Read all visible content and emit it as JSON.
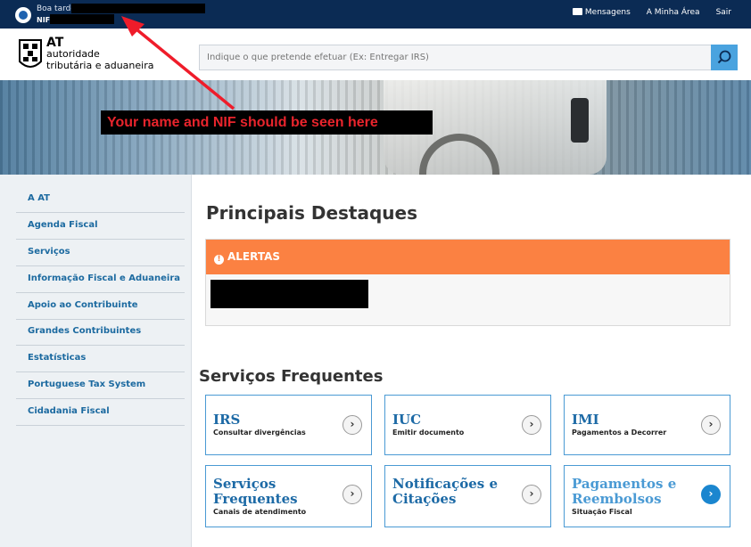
{
  "topbar": {
    "greeting": "Boa tarde",
    "nif_label": "NIF",
    "links": {
      "messages": "Mensagens",
      "my_area": "A Minha Área",
      "logout": "Sair"
    }
  },
  "header": {
    "logo": {
      "at": "AT",
      "line2": "autoridade",
      "line3": "tributária e aduaneira"
    },
    "search": {
      "placeholder": "Indique o que pretende efetuar (Ex: Entregar IRS)"
    }
  },
  "annotation": {
    "text": "Your name and NIF should be seen here",
    "color": "#e8242c"
  },
  "sidebar": {
    "items": [
      {
        "label": "A AT"
      },
      {
        "label": "Agenda Fiscal"
      },
      {
        "label": "Serviços"
      },
      {
        "label": "Informação Fiscal e Aduaneira"
      },
      {
        "label": "Apoio ao Contribuinte"
      },
      {
        "label": "Grandes Contribuintes"
      },
      {
        "label": "Estatísticas"
      },
      {
        "label": "Portuguese Tax System"
      },
      {
        "label": "Cidadania Fiscal"
      }
    ]
  },
  "main": {
    "title": "Principais Destaques",
    "alert": {
      "heading": "ALERTAS",
      "color": "#fb8142"
    },
    "services_title": "Serviços Frequentes",
    "services": [
      {
        "title": "IRS",
        "subtitle": "Consultar divergências"
      },
      {
        "title": "IUC",
        "subtitle": "Emitir documento"
      },
      {
        "title": "IMI",
        "subtitle": "Pagamentos a Decorrer"
      },
      {
        "title_l1": "Serviços",
        "title_l2": "Frequentes",
        "subtitle": "Canais de atendimento"
      },
      {
        "title_l1": "Notificações e",
        "title_l2": "Citações",
        "subtitle": ""
      },
      {
        "title_l1": "Pagamentos e",
        "title_l2": "Reembolsos",
        "subtitle": "Situação Fiscal"
      }
    ]
  },
  "colors": {
    "topbar": "#0b2b54",
    "link": "#1c6aa0",
    "accent": "#4a9ad4"
  }
}
